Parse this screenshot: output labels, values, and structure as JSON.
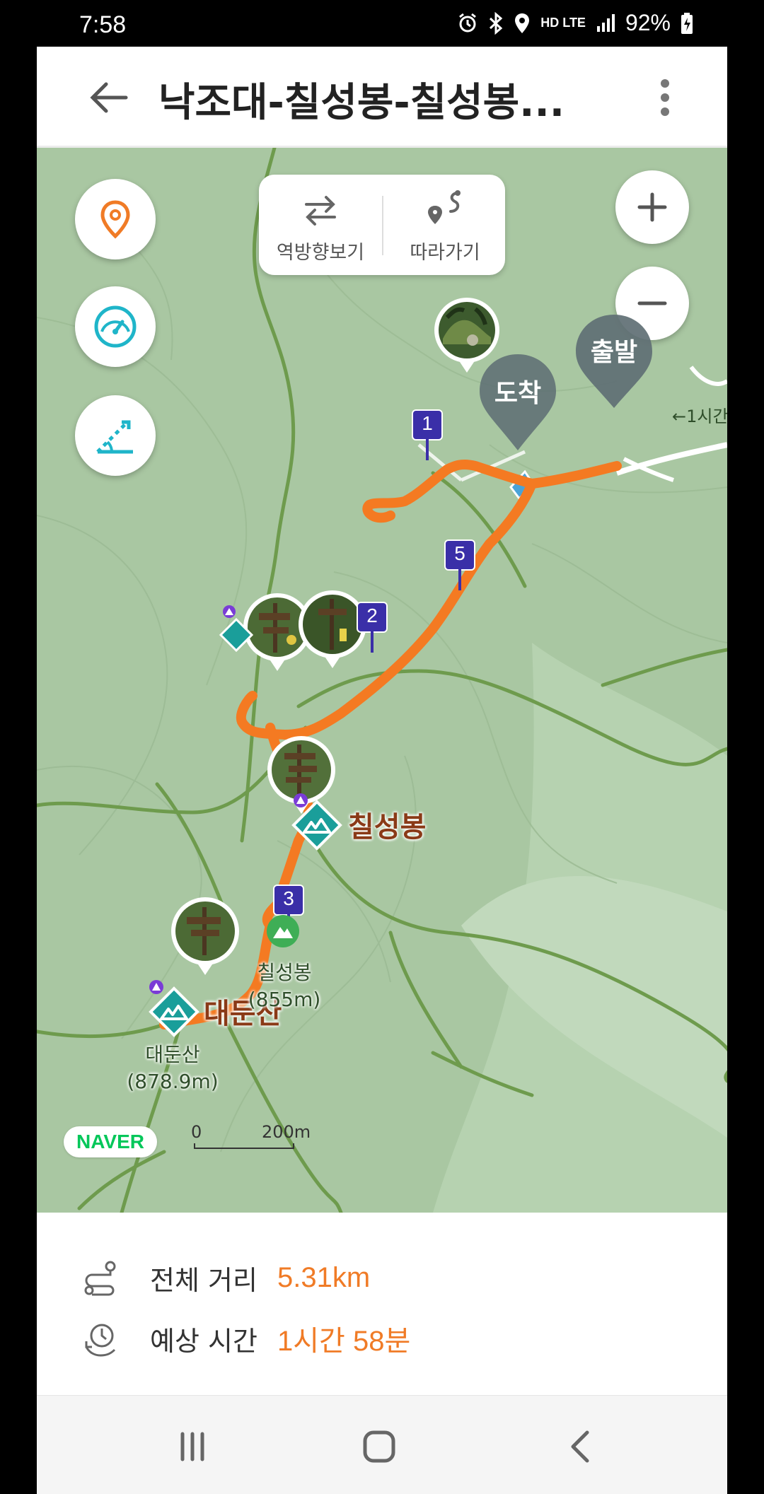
{
  "status_bar": {
    "time": "7:58",
    "battery": "92%",
    "network": "HD LTE"
  },
  "header": {
    "title": "낙조대-칠성봉-칠성봉..."
  },
  "map": {
    "toggle_reverse_label": "역방향보기",
    "toggle_follow_label": "따라가기",
    "start_marker": "출발",
    "end_marker": "도착",
    "waypoints": [
      "1",
      "2",
      "3",
      "5"
    ],
    "peaks": [
      {
        "name": "칠성봉"
      },
      {
        "name": "대둔산"
      }
    ],
    "spot_labels": [
      {
        "name": "칠성봉",
        "elevation": "(855m)"
      },
      {
        "name": "대둔산",
        "elevation": "(878.9m)"
      }
    ],
    "edge_label": "←1시간",
    "scale_zero": "0",
    "scale_label": "200m",
    "provider": "NAVER",
    "colors": {
      "route": "#f47a22",
      "waypoint": "#3a2fa8",
      "marker": "#5f6f74",
      "land": "#a9c7a2",
      "trail": "#6e9b4d"
    }
  },
  "info": {
    "distance_label": "전체 거리",
    "distance_value": "5.31km",
    "time_label": "예상 시간",
    "time_value": "1시간 58분"
  }
}
